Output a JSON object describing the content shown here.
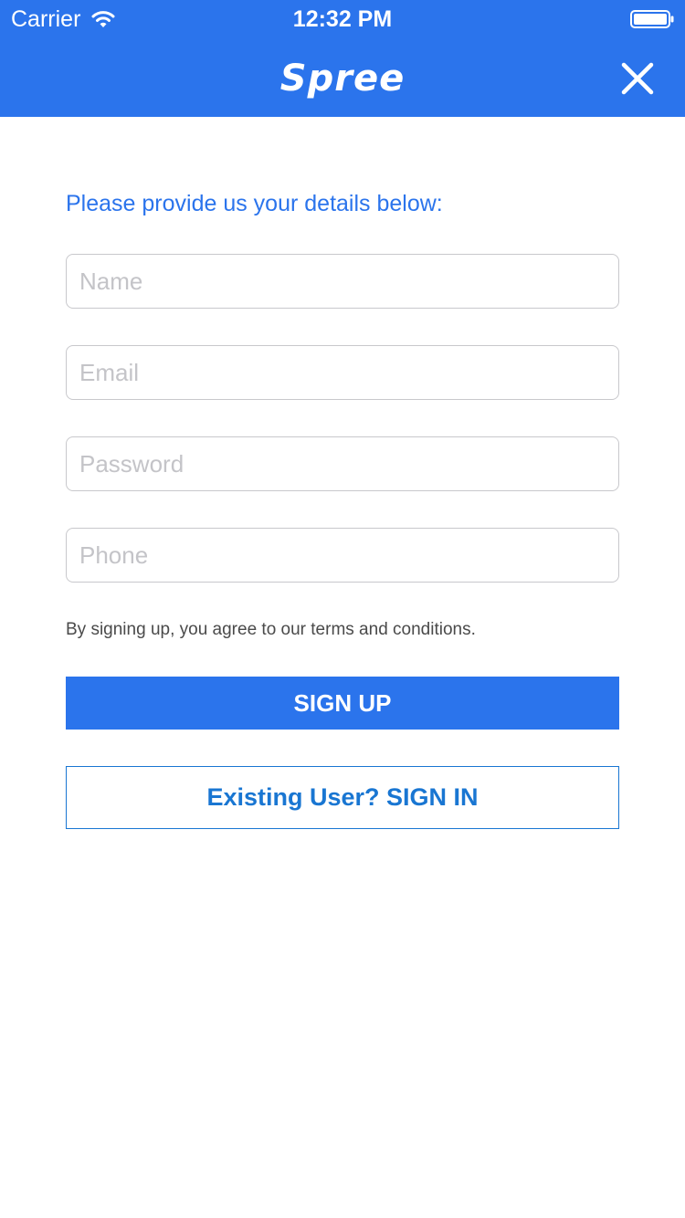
{
  "status_bar": {
    "carrier": "Carrier",
    "time": "12:32 PM",
    "wifi_icon": "wifi-icon",
    "battery_icon": "battery-icon",
    "battery_level": 1.0
  },
  "nav_bar": {
    "title": "Spree",
    "close_icon": "close-icon"
  },
  "form": {
    "intro": "Please provide us your details below:",
    "fields": [
      {
        "placeholder": "Name",
        "value": ""
      },
      {
        "placeholder": "Email",
        "value": ""
      },
      {
        "placeholder": "Password",
        "value": ""
      },
      {
        "placeholder": "Phone",
        "value": ""
      }
    ],
    "terms": "By signing up, you agree to our terms and conditions.",
    "signup_label": "SIGN UP",
    "signin_label": "Existing User? SIGN IN"
  },
  "colors": {
    "brand": "#2b74ec",
    "signin_text": "#1976d2",
    "background": "#ffffff"
  }
}
